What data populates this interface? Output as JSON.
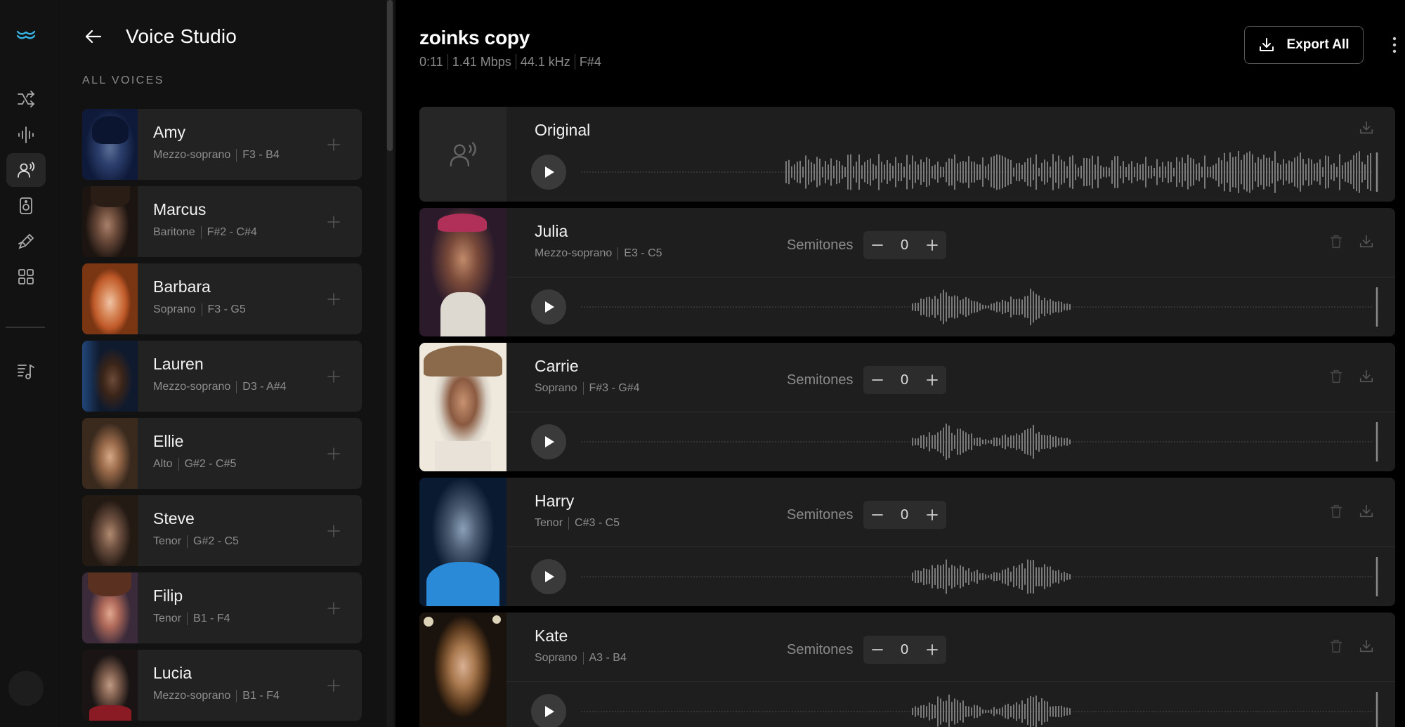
{
  "app": {
    "panel_title": "Voice Studio",
    "section_label": "ALL VOICES"
  },
  "voices": [
    {
      "name": "Amy",
      "type": "Mezzo-soprano",
      "range": "F3 - B4"
    },
    {
      "name": "Marcus",
      "type": "Baritone",
      "range": "F#2 - C#4"
    },
    {
      "name": "Barbara",
      "type": "Soprano",
      "range": "F3 - G5"
    },
    {
      "name": "Lauren",
      "type": "Mezzo-soprano",
      "range": "D3 - A#4"
    },
    {
      "name": "Ellie",
      "type": "Alto",
      "range": "G#2 - C#5"
    },
    {
      "name": "Steve",
      "type": "Tenor",
      "range": "G#2 - C5"
    },
    {
      "name": "Filip",
      "type": "Tenor",
      "range": "B1 - F4"
    },
    {
      "name": "Lucia",
      "type": "Mezzo-soprano",
      "range": "B1 - F4"
    }
  ],
  "project": {
    "title": "zoinks copy",
    "duration": "0:11",
    "bitrate": "1.41 Mbps",
    "sample_rate": "44.1 kHz",
    "key": "F#4",
    "export_label": "Export All"
  },
  "tracks": [
    {
      "name": "Original"
    },
    {
      "name": "Julia",
      "type": "Mezzo-soprano",
      "range": "E3 - C5",
      "semitones_label": "Semitones",
      "semitones": "0"
    },
    {
      "name": "Carrie",
      "type": "Soprano",
      "range": "F#3 - G#4",
      "semitones_label": "Semitones",
      "semitones": "0"
    },
    {
      "name": "Harry",
      "type": "Tenor",
      "range": "C#3 - C5",
      "semitones_label": "Semitones",
      "semitones": "0"
    },
    {
      "name": "Kate",
      "type": "Soprano",
      "range": "A3 - B4",
      "semitones_label": "Semitones",
      "semitones": "0"
    }
  ],
  "icons": {
    "logo": "wave-logo-icon",
    "rail": [
      "shuffle-icon",
      "waveform-icon",
      "voice-icon",
      "speaker-icon",
      "edit-icon",
      "grid-icon",
      "playlist-icon"
    ]
  },
  "colors": {
    "background": "#000000",
    "panel": "#121212",
    "card": "#222222",
    "accent": "#37b3e4"
  }
}
